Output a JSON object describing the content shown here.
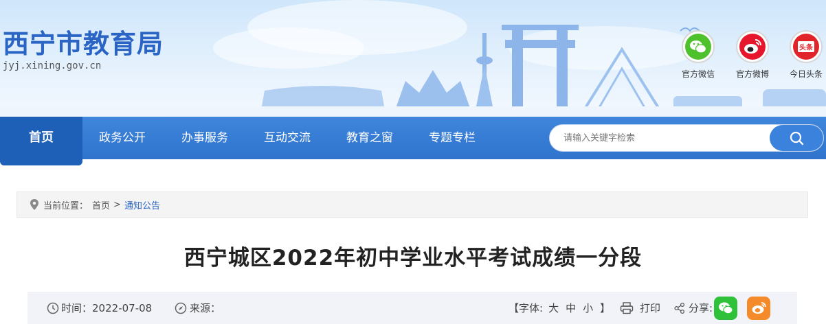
{
  "header": {
    "title": "西宁市教育局",
    "domain": "jyj.xining.gov.cn",
    "social": [
      {
        "label": "官方微信",
        "icon": "wechat-icon",
        "color": "#4fc12c"
      },
      {
        "label": "官方微博",
        "icon": "weibo-icon",
        "color": "#e6162d"
      },
      {
        "label": "今日头条",
        "icon": "toutiao-icon",
        "color": "#e0242a",
        "badge": "头条"
      }
    ]
  },
  "nav": {
    "items": [
      "首页",
      "政务公开",
      "办事服务",
      "互动交流",
      "教育之窗",
      "专题专栏"
    ],
    "active_color": "#1e5fb8"
  },
  "search": {
    "placeholder": "请输入关键字检索",
    "icon": "search-icon"
  },
  "breadcrumb": {
    "label": "当前位置：",
    "items": [
      "首页",
      "通知公告"
    ],
    "separator": ">"
  },
  "article": {
    "title": "西宁城区2022年初中学业水平考试成绩一分段",
    "time_label": "时间：",
    "time": "2022-07-08",
    "source_label": "来源：",
    "font_label": "【字体:",
    "font_sizes": [
      "大",
      "中",
      "小"
    ],
    "font_end": "】",
    "print": "打印",
    "share": "分享:"
  },
  "colors": {
    "brand": "#2a64c4",
    "nav": "#3479d4",
    "wechat_share": "#2fc13a",
    "weibo_share": "#f58a2a"
  }
}
